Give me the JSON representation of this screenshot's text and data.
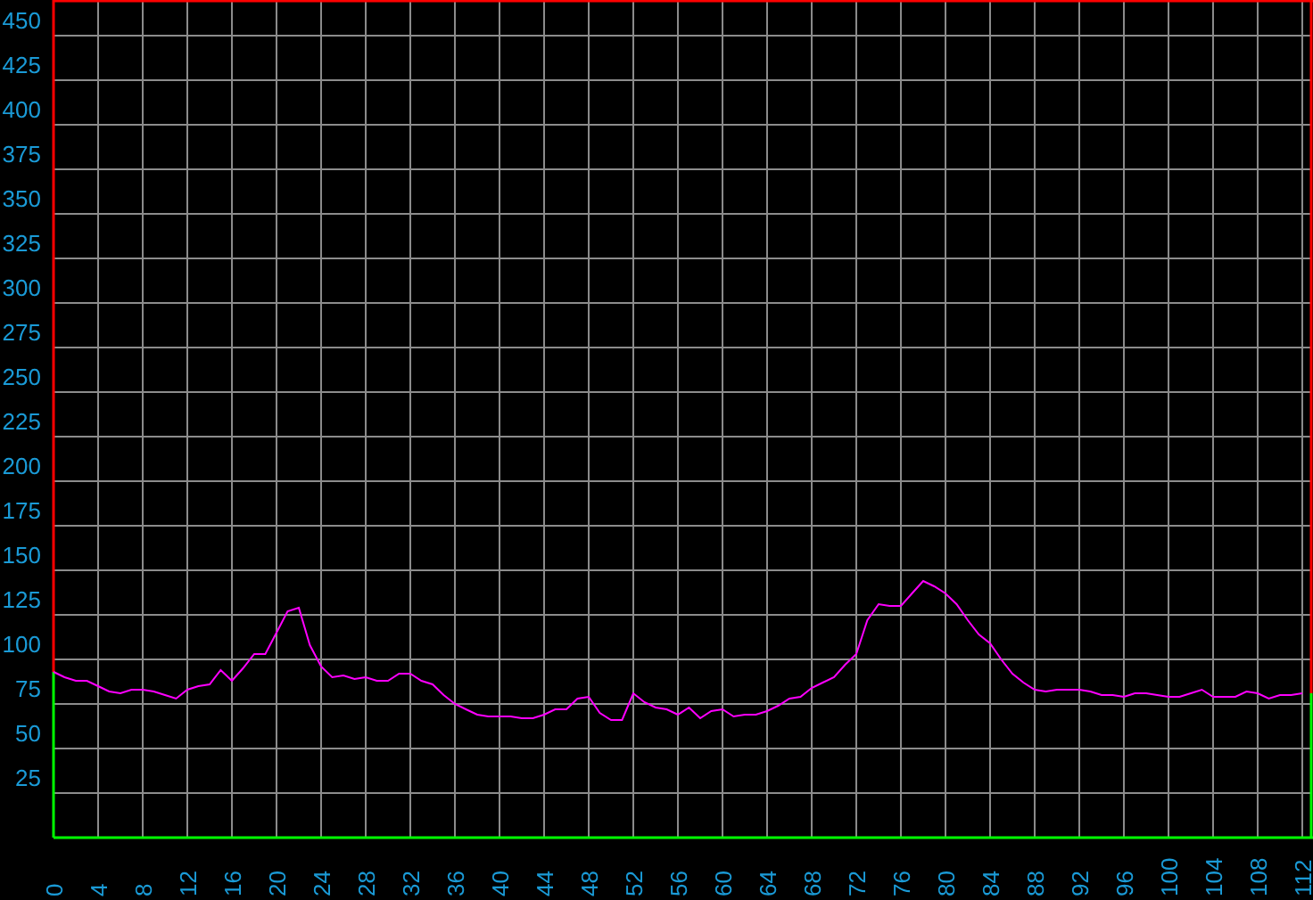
{
  "chart_data": {
    "type": "line",
    "grid": true,
    "x": [
      0,
      1,
      2,
      3,
      4,
      5,
      6,
      7,
      8,
      9,
      10,
      11,
      12,
      13,
      14,
      15,
      16,
      17,
      18,
      19,
      20,
      21,
      22,
      23,
      24,
      25,
      26,
      27,
      28,
      29,
      30,
      31,
      32,
      33,
      34,
      35,
      36,
      37,
      38,
      39,
      40,
      41,
      42,
      43,
      44,
      45,
      46,
      47,
      48,
      49,
      50,
      51,
      52,
      53,
      54,
      55,
      56,
      57,
      58,
      59,
      60,
      61,
      62,
      63,
      64,
      65,
      66,
      67,
      68,
      69,
      70,
      71,
      72,
      73,
      74,
      75,
      76,
      77,
      78,
      79,
      80,
      81,
      82,
      83,
      84,
      85,
      86,
      87,
      88,
      89,
      90,
      91,
      92,
      93,
      94,
      95,
      96,
      97,
      98,
      99,
      100,
      101,
      102,
      103,
      104,
      105,
      106,
      107,
      108,
      109,
      110,
      111,
      112
    ],
    "series": [
      {
        "color": "#ff00ff",
        "values": [
          93,
          90,
          88,
          88,
          85,
          82,
          81,
          83,
          83,
          82,
          80,
          78,
          83,
          85,
          86,
          94,
          88,
          95,
          103,
          103,
          115,
          127,
          129,
          108,
          96,
          90,
          91,
          89,
          90,
          88,
          88,
          92,
          92,
          88,
          86,
          80,
          75,
          72,
          69,
          68,
          68,
          68,
          67,
          67,
          69,
          72,
          72,
          78,
          79,
          70,
          66,
          66,
          81,
          76,
          73,
          72,
          69,
          73,
          67,
          71,
          72,
          68,
          69,
          69,
          71,
          74,
          78,
          79,
          84,
          87,
          90,
          97,
          103,
          122,
          131,
          130,
          130,
          137,
          144,
          141,
          137,
          131,
          122,
          114,
          109,
          100,
          92,
          87,
          83,
          82,
          83,
          83,
          83,
          82,
          80,
          80,
          79,
          81,
          81,
          80,
          79,
          79,
          81,
          83,
          79,
          79,
          79,
          82,
          81,
          78,
          80,
          80,
          81
        ]
      }
    ],
    "xlim": [
      0,
      112.93
    ],
    "ylim": [
      0,
      470
    ],
    "xticks": [
      0,
      4,
      8,
      12,
      16,
      20,
      24,
      28,
      32,
      36,
      40,
      44,
      48,
      52,
      56,
      60,
      64,
      68,
      72,
      76,
      80,
      84,
      88,
      92,
      96,
      100,
      104,
      108,
      112
    ],
    "yticks": [
      25,
      50,
      75,
      100,
      125,
      150,
      175,
      200,
      225,
      250,
      275,
      300,
      325,
      350,
      375,
      400,
      425,
      450
    ]
  }
}
